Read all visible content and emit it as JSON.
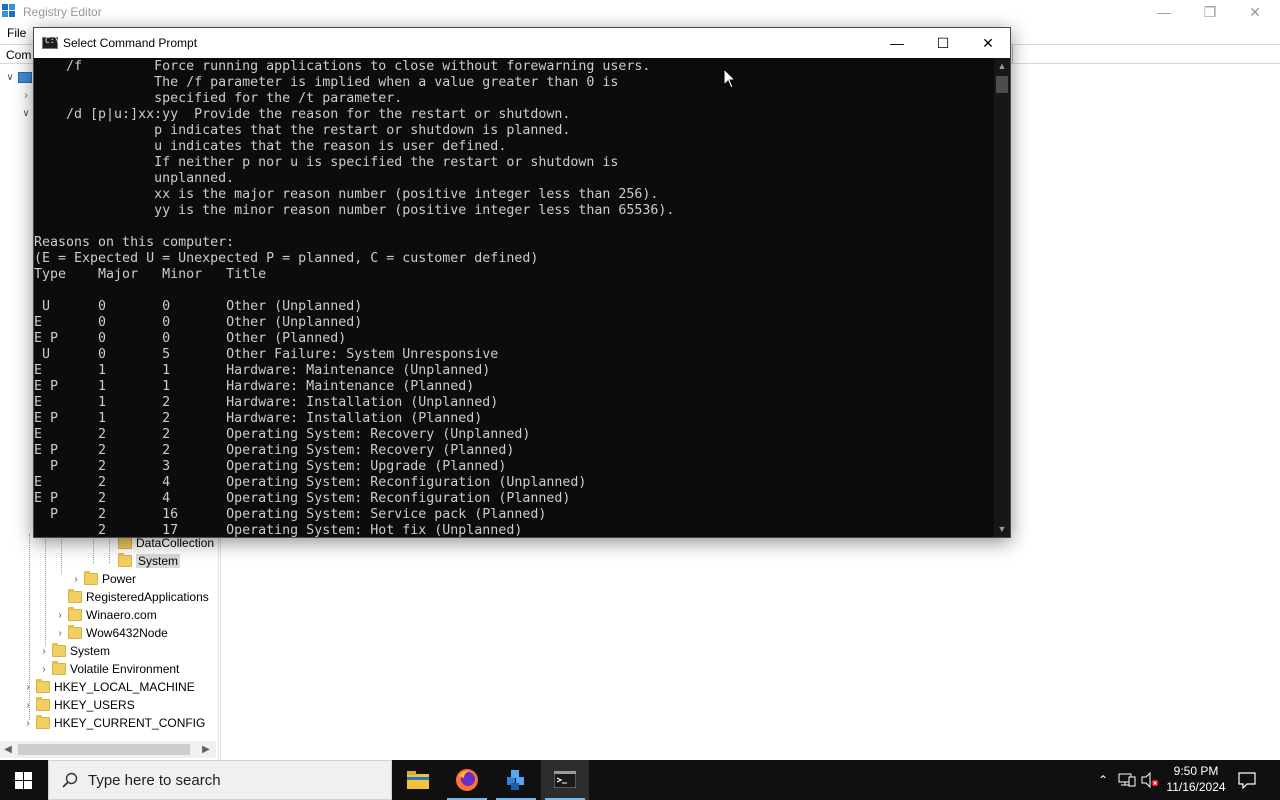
{
  "registry": {
    "title": "Registry Editor",
    "menu_file": "File",
    "address_partial": "Com",
    "tree": [
      {
        "label": "DataCollection",
        "indent": 3
      },
      {
        "label": "System",
        "indent": 3,
        "selected": true
      },
      {
        "label": "Power",
        "indent": 2
      },
      {
        "label": "RegisteredApplications",
        "indent": 1
      },
      {
        "label": "Winaero.com",
        "indent": 1
      },
      {
        "label": "Wow6432Node",
        "indent": 1
      },
      {
        "label": "System",
        "indent": 0
      },
      {
        "label": "Volatile Environment",
        "indent": 0
      },
      {
        "label": "HKEY_LOCAL_MACHINE",
        "indent": -1
      },
      {
        "label": "HKEY_USERS",
        "indent": -1
      },
      {
        "label": "HKEY_CURRENT_CONFIG",
        "indent": -1
      }
    ]
  },
  "cmd": {
    "title": "Select Command Prompt",
    "lines": [
      "    /f         Force running applications to close without forewarning users.",
      "               The /f parameter is implied when a value greater than 0 is",
      "               specified for the /t parameter.",
      "    /d [p|u:]xx:yy  Provide the reason for the restart or shutdown.",
      "               p indicates that the restart or shutdown is planned.",
      "               u indicates that the reason is user defined.",
      "               If neither p nor u is specified the restart or shutdown is",
      "               unplanned.",
      "               xx is the major reason number (positive integer less than 256).",
      "               yy is the minor reason number (positive integer less than 65536).",
      "",
      "Reasons on this computer:",
      "(E = Expected U = Unexpected P = planned, C = customer defined)",
      "Type    Major   Minor   Title",
      "",
      " U      0       0       Other (Unplanned)",
      "E       0       0       Other (Unplanned)",
      "E P     0       0       Other (Planned)",
      " U      0       5       Other Failure: System Unresponsive",
      "E       1       1       Hardware: Maintenance (Unplanned)",
      "E P     1       1       Hardware: Maintenance (Planned)",
      "E       1       2       Hardware: Installation (Unplanned)",
      "E P     1       2       Hardware: Installation (Planned)",
      "E       2       2       Operating System: Recovery (Unplanned)",
      "E P     2       2       Operating System: Recovery (Planned)",
      "  P     2       3       Operating System: Upgrade (Planned)",
      "E       2       4       Operating System: Reconfiguration (Unplanned)",
      "E P     2       4       Operating System: Reconfiguration (Planned)",
      "  P     2       16      Operating System: Service pack (Planned)",
      "        2       17      Operating System: Hot fix (Unplanned)"
    ]
  },
  "taskbar": {
    "search_placeholder": "Type here to search",
    "time": "9:50 PM",
    "date": "11/16/2024"
  }
}
